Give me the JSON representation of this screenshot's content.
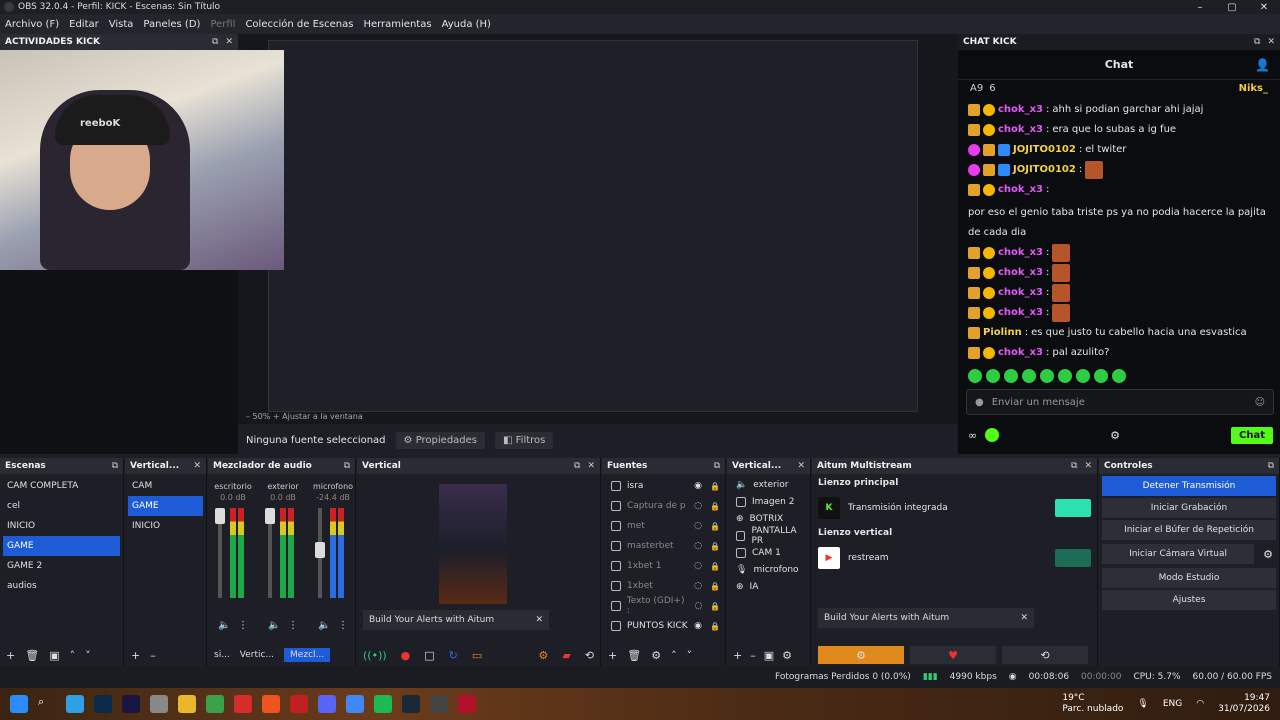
{
  "window": {
    "title": "OBS 32.0.4 - Perfil: KICK - Escenas: Sin Título"
  },
  "menu": [
    "Archivo (F)",
    "Editar",
    "Vista",
    "Paneles (D)",
    "Perfil",
    "Colección de Escenas",
    "Herramientas",
    "Ayuda (H)"
  ],
  "activities": {
    "title": "ACTIVIDADES KICK"
  },
  "webcam": {
    "beanie_text": "reeboK"
  },
  "preview": {
    "zoom": "50%",
    "fit": "Ajustar a la ventana"
  },
  "source_bar": {
    "none": "Ninguna fuente seleccionad",
    "props": "Propiedades",
    "filters": "Filtros"
  },
  "chat": {
    "dock_title": "CHAT KICK",
    "title": "Chat",
    "sub_left": "A9",
    "sub_count": "6",
    "sub_right": "Niks_",
    "messages": [
      {
        "user": "chok_x3",
        "text": "ahh si podian garchar ahi jajaj"
      },
      {
        "user": "chok_x3",
        "text": "era que lo subas a ig fue"
      },
      {
        "user": "JOJITO0102",
        "text": "el twiter"
      },
      {
        "user": "JOJITO0102",
        "text": ""
      },
      {
        "user": "chok_x3",
        "text": "por eso el genio taba triste ps ya no podia hacerce la pajita de cada dia"
      },
      {
        "user": "chok_x3",
        "text": ""
      },
      {
        "user": "chok_x3",
        "text": ""
      },
      {
        "user": "chok_x3",
        "text": ""
      },
      {
        "user": "chok_x3",
        "text": ""
      },
      {
        "user": "Piolinn",
        "text": "es que justo tu cabello hacia una esvastica"
      },
      {
        "user": "chok_x3",
        "text": "pal azulito?"
      }
    ],
    "input_placeholder": "Enviar un mensaje",
    "send": "Chat"
  },
  "scenes": {
    "title": "Escenas",
    "items": [
      "CAM COMPLETA",
      "cel",
      "INICIO",
      "GAME",
      "GAME 2",
      "audios"
    ],
    "selected": "GAME"
  },
  "vertical_scenes": {
    "title": "Vertical...",
    "items": [
      "CAM",
      "GAME",
      "INICIO"
    ],
    "selected": "GAME"
  },
  "mixer": {
    "title": "Mezclador de audio",
    "channels": [
      {
        "name": "escritorio",
        "db": "0.0 dB"
      },
      {
        "name": "exterior",
        "db": "0.0 dB"
      },
      {
        "name": "microfono",
        "db": "-24.4 dB"
      }
    ],
    "tabs": [
      "si...",
      "Vertic...",
      "Mezcl..."
    ]
  },
  "vertical": {
    "title": "Vertical",
    "alert": "Build Your Alerts with Aitum"
  },
  "sources": {
    "title": "Fuentes",
    "items": [
      {
        "name": "isra",
        "dim": false
      },
      {
        "name": "Captura de p",
        "dim": true
      },
      {
        "name": "met",
        "dim": true
      },
      {
        "name": "masterbet",
        "dim": true
      },
      {
        "name": "1xbet 1",
        "dim": true
      },
      {
        "name": "1xbet",
        "dim": true
      },
      {
        "name": "Texto (GDI+) :",
        "dim": true
      },
      {
        "name": "PUNTOS KICK",
        "dim": false
      }
    ]
  },
  "vertical_sources": {
    "title": "Vertical...",
    "items": [
      "exterior",
      "Imagen 2",
      "BOTRIX",
      "PANTALLA PR",
      "CAM 1",
      "microfono",
      "IA"
    ]
  },
  "aitum": {
    "title": "Aitum Multistream",
    "main_canvas": "Lienzo principal",
    "main_stream": "Transmisión integrada",
    "vertical_canvas": "Lienzo vertical",
    "vertical_stream": "restream",
    "alert": "Build Your Alerts with Aitum"
  },
  "controls": {
    "title": "Controles",
    "buttons": [
      "Detener Transmisión",
      "Iniciar Grabación",
      "Iniciar el Búfer de Repetición",
      "Iniciar Cámara Virtual",
      "Modo Estudio",
      "Ajustes"
    ]
  },
  "status": {
    "frames": "Fotogramas Perdidos 0 (0.0%)",
    "kbps": "4990 kbps",
    "live": "00:08:06",
    "rec": "00:00:00",
    "cpu": "CPU: 5.7%",
    "fps": "60.00 / 60.00 FPS"
  },
  "taskbar": {
    "weather_temp": "19°C",
    "weather_desc": "Parc. nublado",
    "lang": "ENG",
    "time": "19:47",
    "date": "31/07/2026"
  }
}
